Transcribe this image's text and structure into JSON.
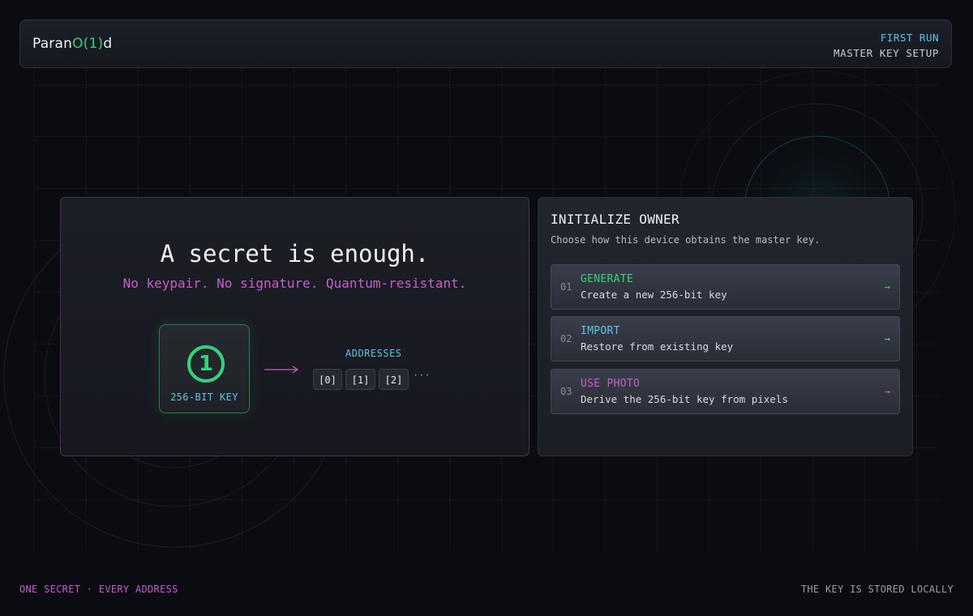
{
  "header": {
    "brand_prefix": "Paran",
    "brand_highlight": "O(1)",
    "brand_suffix": "d",
    "stage": "FIRST RUN",
    "step": "MASTER KEY SETUP"
  },
  "hero": {
    "headline": "A secret is enough.",
    "tagline": "No keypair. No signature. Quantum-resistant.",
    "key_glyph": "1",
    "key_label": "256-BIT KEY",
    "addresses_label": "ADDRESSES",
    "addresses": [
      "[0]",
      "[1]",
      "[2]"
    ],
    "ellipsis": "···"
  },
  "init": {
    "title": "INITIALIZE OWNER",
    "subtitle": "Choose how this device obtains the master key.",
    "options": [
      {
        "index": "01",
        "name": "GENERATE",
        "description": "Create a new 256-bit key",
        "arrow": "→",
        "color": "#34d17a"
      },
      {
        "index": "02",
        "name": "IMPORT",
        "description": "Restore from existing key",
        "arrow": "→",
        "color": "#5cc6e6"
      },
      {
        "index": "03",
        "name": "USE PHOTO",
        "description": "Derive the 256-bit key from pixels",
        "arrow": "→",
        "color": "#c55ec9"
      }
    ]
  },
  "footer": {
    "left": "ONE SECRET · EVERY ADDRESS",
    "right": "THE KEY IS STORED LOCALLY"
  },
  "colors": {
    "accent_green": "#34d17a",
    "accent_cyan": "#5cc6e6",
    "accent_magenta": "#c55ec9",
    "background": "#0a0c12"
  }
}
